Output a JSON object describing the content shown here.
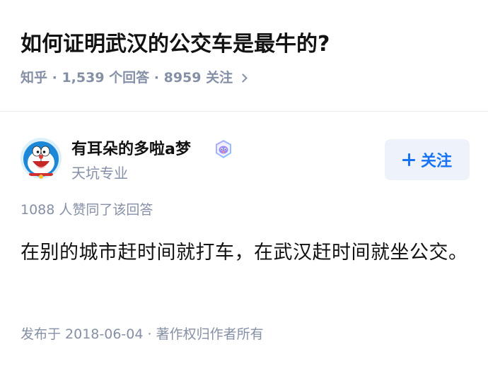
{
  "question": {
    "title": "如何证明武汉的公交车是最牛的?",
    "meta": "知乎 · 1,539 个回答 · 8959 关注"
  },
  "author": {
    "name": "有耳朵的多啦a梦",
    "headline": "天坑专业",
    "follow_label": "关注"
  },
  "answer": {
    "votes": "1088 人赞同了该回答",
    "content": "在别的城市赶时间就打车，在武汉赶时间就坐公交。",
    "footer": "发布于 2018-06-04 · 著作权归作者所有"
  },
  "colors": {
    "accent": "#1772f6",
    "follow_bg": "#eef3fb",
    "meta_gray": "#8590a6",
    "title_black": "#121212"
  },
  "icons": {
    "avatar": "doraemon-avatar",
    "badge": "creator-badge-icon",
    "follow": "plus-icon",
    "meta_chevron": "chevron-right-icon"
  }
}
